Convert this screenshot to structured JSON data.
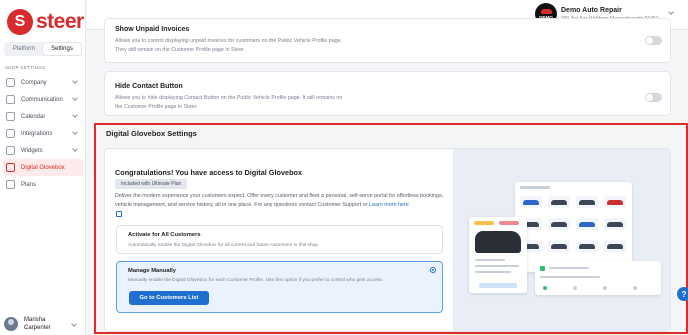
{
  "brand": {
    "name": "steer"
  },
  "sidebar": {
    "tabs": [
      {
        "label": "Platform",
        "active": false
      },
      {
        "label": "Settings",
        "active": true
      }
    ],
    "section_label": "SHOP SETTINGS",
    "items": [
      {
        "label": "Company",
        "icon": "building-icon",
        "has_chevron": true
      },
      {
        "label": "Communication",
        "icon": "megaphone-icon",
        "has_chevron": true
      },
      {
        "label": "Calendar",
        "icon": "calendar-icon",
        "has_chevron": true
      },
      {
        "label": "Integrations",
        "icon": "integrations-icon",
        "has_chevron": true
      },
      {
        "label": "Widgets",
        "icon": "widgets-icon",
        "has_chevron": true
      },
      {
        "label": "Digital Glovebox",
        "icon": "car-icon",
        "has_chevron": false,
        "active": true
      },
      {
        "label": "Plans",
        "icon": "plans-icon",
        "has_chevron": false
      }
    ],
    "user": {
      "first_name": "Marisha",
      "last_name": "Carpenter"
    }
  },
  "header": {
    "shop_logo_text": "DEMO",
    "shop_name": "Demo Auto Repair",
    "shop_address": "230 3rd Ave Waltham Massachusetts 02451"
  },
  "settings": {
    "unpaid_invoices": {
      "title": "Show Unpaid Invoices",
      "description": "Allows you to control displaying unpaid invoices for customers on the Public Vehicle Profile page. They still remain on the Customer Profile page in Steer.",
      "enabled": false
    },
    "hide_contact": {
      "title": "Hide Contact Button",
      "description": "Allows you to hide displaying Contact Button on the Public Vehicle Profile page. It still remains on the Customer Profile page in Steer.",
      "enabled": false
    }
  },
  "glovebox": {
    "section_title": "Digital Glovebox Settings",
    "congrats": "Congratulations! You have access to Digital Glovebox",
    "badge": "Included with Ultimate Plan",
    "description": "Deliver the modern experience your customers expect. Offer every customer and fleet a personal, self-serve portal for effortless bookings, vehicle management, and service history, all in one place. For any questions contact Customer Support or",
    "learn_more": "Learn more here",
    "options": [
      {
        "title": "Activate for All Customers",
        "description": "Automatically enable the Digital Glovebox for all current and future customers in this shop.",
        "selected": false
      },
      {
        "title": "Manage Manually",
        "description": "Manually enable the Digital Glovebox for each Customer Profile. Use this option if you prefer to control who gets access.",
        "selected": true,
        "button": "Go to Customers List"
      }
    ]
  },
  "help_label": "?",
  "colors": {
    "brand_red": "#d92b2b",
    "primary_blue": "#1f6fd1",
    "highlight_frame": "#e02a2a"
  }
}
